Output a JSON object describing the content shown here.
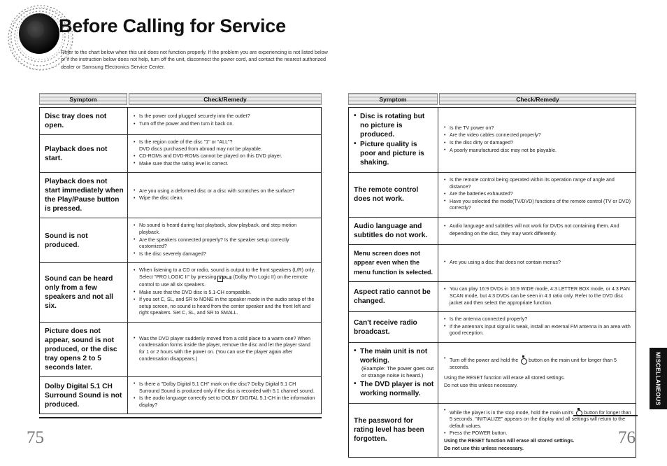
{
  "document": {
    "title": "Before Calling for Service",
    "intro": "Refer to the chart below when this unit does not function properly. If the problem you are experiencing is not listed below or if the instruction below does not help, turn off the unit, disconnect the power cord, and contact the nearest authorized dealer or Samsung Electronics Service Center.",
    "left_page_number": "75",
    "right_page_number": "76",
    "side_tab_label": "MISCELLANEOUS"
  },
  "columns": {
    "symptom": "Symptom",
    "check_remedy": "Check/Remedy"
  },
  "left_table": {
    "rows": [
      {
        "symptom": [
          "Disc tray does not open."
        ],
        "remedy": [
          "Is the power cord plugged securely into the outlet?",
          "Turn off the power and then turn it back on."
        ]
      },
      {
        "symptom": [
          "Playback does not start."
        ],
        "remedy": [
          "Is the region code of the disc \"1\" or \"ALL\"?\nDVD discs purchased from abroad may not be playable.",
          "CD-ROMs and DVD-ROMs cannot be played on this DVD player.",
          "Make sure that the rating level is correct."
        ]
      },
      {
        "symptom": [
          "Playback does not start immediately when the Play/Pause button is pressed."
        ],
        "remedy": [
          "Are you using a deformed disc or a disc with scratches on the surface?",
          "Wipe the disc clean."
        ]
      },
      {
        "symptom": [
          "Sound is not produced."
        ],
        "remedy": [
          "No sound is heard during fast playback, slow playback, and step motion playback.",
          "Are the speakers connected properly? Is the speaker setup correctly customized?",
          "Is the disc severely damaged?"
        ]
      },
      {
        "symptom": [
          "Sound can be heard only from a few speakers and not all six."
        ],
        "remedy": [
          "When listening to a CD or radio, sound is output to the front speakers (L/R) only. Select \"PRO LOGIC II\" by pressing [DOLBY-PL-II] (Dolby Pro Logic II) on the remote control to use all six speakers.",
          "Make sure that the DVD disc is 5.1-CH compatible.",
          "If you set C, SL, and SR to NONE in the speaker mode in the audio setup of the setup screen, no sound is heard from the center speaker and the front left and right speakers. Set C, SL, and SR to SMALL."
        ]
      },
      {
        "symptom": [
          "Picture does not appear, sound is not produced, or the disc tray opens 2 to 5 seconds later."
        ],
        "remedy": [
          "Was the DVD player suddenly moved from a cold place to a warm one? When condensation forms inside the player, remove the disc and let the player stand for 1 or 2 hours with the power on. (You can use the player again after condensation disappears.)"
        ]
      },
      {
        "symptom": [
          "Dolby Digital 5.1 CH Surround Sound is not produced."
        ],
        "remedy": [
          "Is there a \"Dolby Digital 5.1 CH\" mark on the disc? Dolby Digital 5.1 CH Surround Sound is produced only if the disc is recorded with 5.1 channel sound.",
          "Is the audio language correctly set to DOLBY DIGITAL 5.1-CH in the information display?"
        ]
      }
    ]
  },
  "right_table": {
    "rows": [
      {
        "symptom_bullets": [
          "Disc is rotating but no picture is produced.",
          "Picture quality is poor and picture is shaking."
        ],
        "remedy": [
          "Is the TV power on?",
          "Are the video cables connected properly?",
          "Is the disc dirty or damaged?",
          "A poorly manufactured disc may not be playable."
        ]
      },
      {
        "symptom": [
          "The remote control does not work."
        ],
        "remedy": [
          "Is the remote control being operated within its operation range of angle and distance?",
          "Are the batteries exhausted?",
          "Have you selected the mode(TV/DVD) functions of the remote control (TV or DVD) correctly?"
        ]
      },
      {
        "symptom": [
          "Audio language and subtitles do not work."
        ],
        "remedy": [
          "Audio language and subtitles will not work for DVDs not containing them. And depending on the disc, they may work differently."
        ]
      },
      {
        "symptom_small": [
          "Menu screen does not appear even when the menu function is selected."
        ],
        "remedy": [
          "Are you using a disc that does not contain menus?"
        ]
      },
      {
        "symptom": [
          "Aspect ratio cannot be changed."
        ],
        "remedy": [
          "You can play 16:9 DVDs in 16:9 WIDE mode, 4:3 LETTER BOX mode, or 4:3 PAN SCAN mode, but 4:3 DVDs can be seen in 4:3 ratio only. Refer to the DVD disc jacket and then select the appropriate function."
        ]
      },
      {
        "symptom": [
          "Can't receive radio broadcast."
        ],
        "remedy": [
          "Is the antenna connected properly?",
          "If the antenna's input signal is weak, install an external FM antenna in an area with good reception."
        ]
      },
      {
        "symptom_bullets": [
          "The main unit is not working.",
          "The DVD player is not working normally."
        ],
        "symptom_sub": "(Example: The power goes out or strange noise is heard.)",
        "remedy_icon_line_pre": "Turn off the power and hold the",
        "remedy_icon_line_post": "button on the main unit for longer than 5 seconds.",
        "remedy_notes": [
          "Using the RESET function will erase all stored settings.",
          "Do not use this unless necessary."
        ]
      },
      {
        "symptom": [
          "The password for rating level has been forgotten."
        ],
        "remedy_icon_line_pre": "While the player is in the stop mode, hold the main unit's",
        "remedy_icon_line_post": "button for longer than 5 seconds. \"INITIALIZE\" appears on the display and all settings will return to the default values.",
        "remedy_extra": [
          "Press the POWER button."
        ],
        "remedy_notes_bold": [
          "Using the RESET function will erase all stored settings.",
          "Do not use this unless necessary."
        ]
      }
    ]
  }
}
